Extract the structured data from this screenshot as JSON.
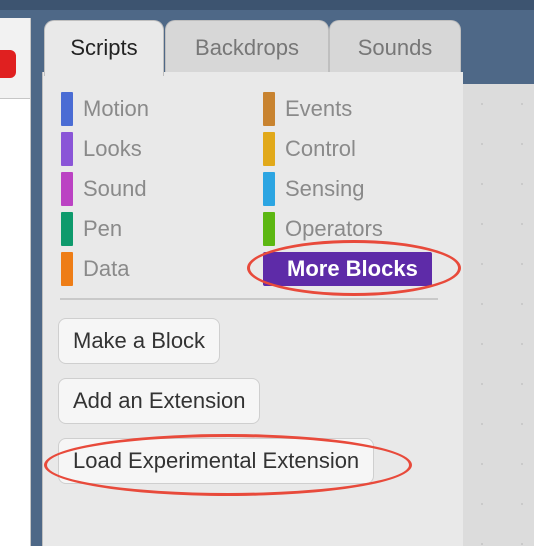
{
  "tabs": [
    {
      "label": "Scripts"
    },
    {
      "label": "Backdrops"
    },
    {
      "label": "Sounds"
    }
  ],
  "categories": {
    "left": [
      {
        "label": "Motion",
        "color": "#4a6cd4"
      },
      {
        "label": "Looks",
        "color": "#8a55d7"
      },
      {
        "label": "Sound",
        "color": "#bb42c3"
      },
      {
        "label": "Pen",
        "color": "#0e9a6c"
      },
      {
        "label": "Data",
        "color": "#ee7d16"
      }
    ],
    "right": [
      {
        "label": "Events",
        "color": "#c88330"
      },
      {
        "label": "Control",
        "color": "#e1a91a"
      },
      {
        "label": "Sensing",
        "color": "#2ca5e2"
      },
      {
        "label": "Operators",
        "color": "#5cb712"
      },
      {
        "label": "More Blocks",
        "color": "#632d99"
      }
    ]
  },
  "buttons": {
    "make_block": "Make a Block",
    "add_extension": "Add an Extension",
    "load_experimental": "Load Experimental Extension"
  },
  "colors": {
    "highlight_ring": "#e84a3b",
    "selected_category": "#5e2ba8",
    "background": "#4e6887"
  }
}
